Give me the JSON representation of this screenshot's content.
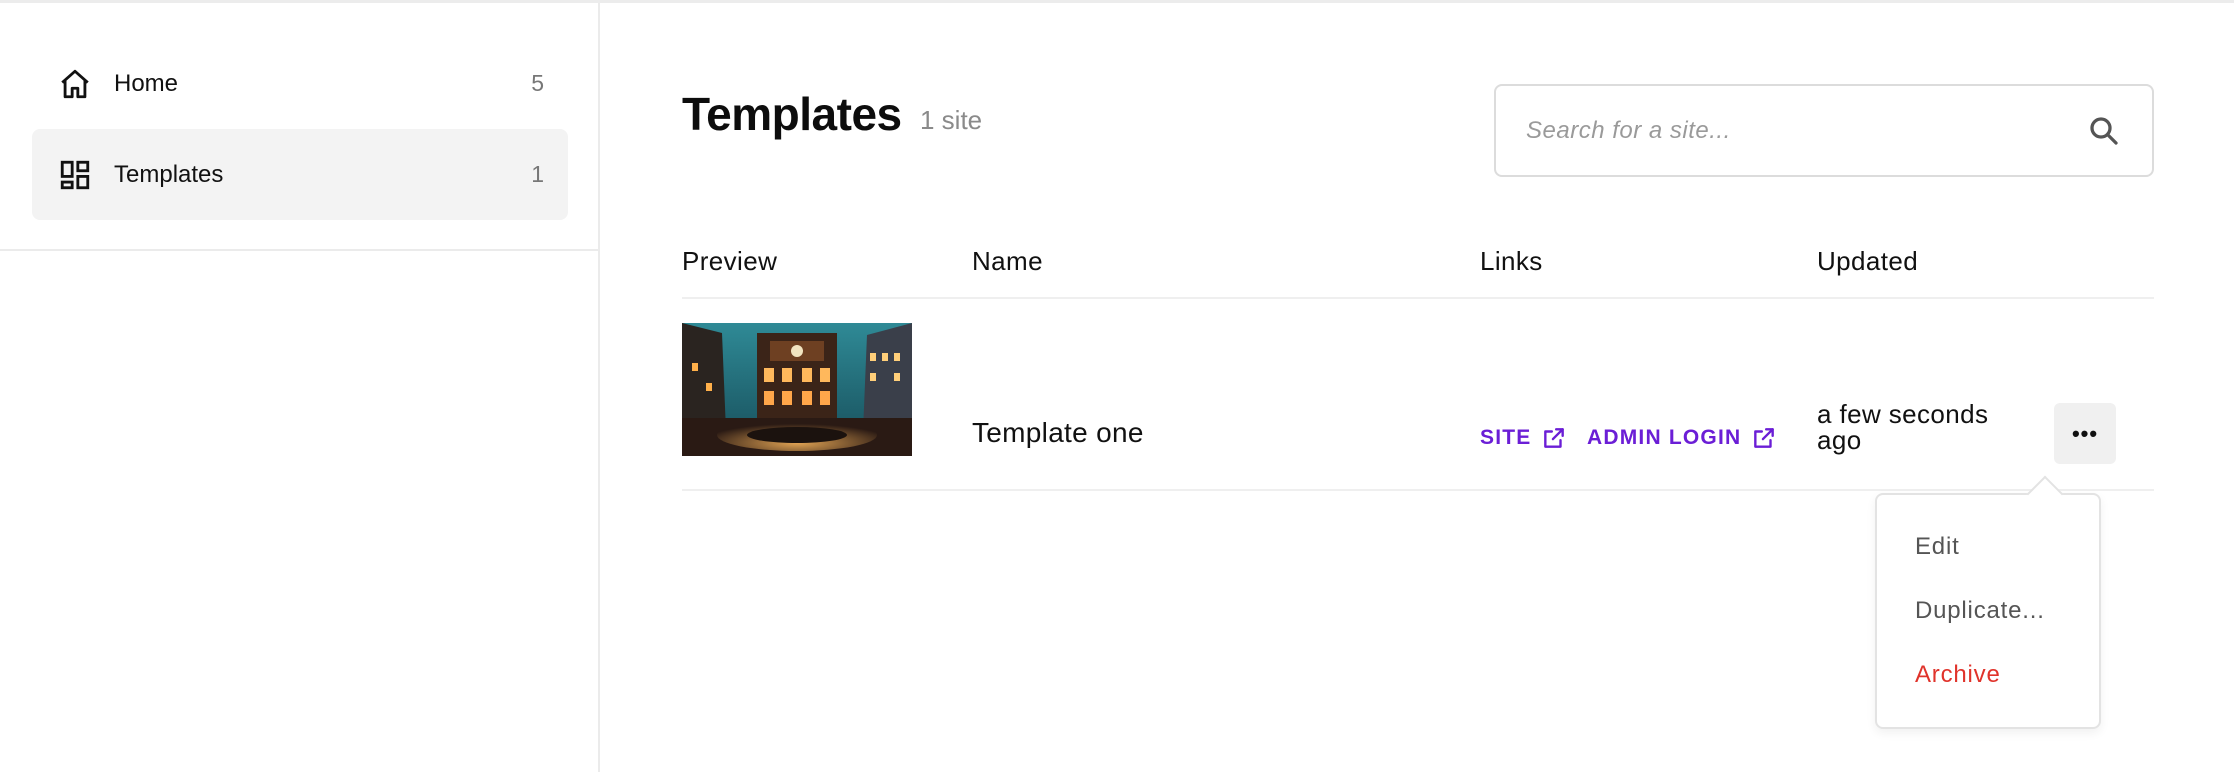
{
  "sidebar": {
    "items": [
      {
        "label": "Home",
        "count": "5",
        "icon": "home-icon",
        "active": false
      },
      {
        "label": "Templates",
        "count": "1",
        "icon": "templates-icon",
        "active": true
      }
    ]
  },
  "header": {
    "title": "Templates",
    "count": "1 site"
  },
  "search": {
    "placeholder": "Search for a site...",
    "value": ""
  },
  "table": {
    "columns": [
      "Preview",
      "Name",
      "Links",
      "Updated"
    ],
    "rows": [
      {
        "name": "Template one",
        "links": [
          "SITE",
          "ADMIN LOGIN"
        ],
        "updated": "a few seconds ago"
      }
    ]
  },
  "menu": {
    "items": [
      "Edit",
      "Duplicate...",
      "Archive"
    ]
  },
  "colors": {
    "link": "#6b1ed6",
    "danger": "#e0332b",
    "active_bg": "#f3f3f3"
  }
}
